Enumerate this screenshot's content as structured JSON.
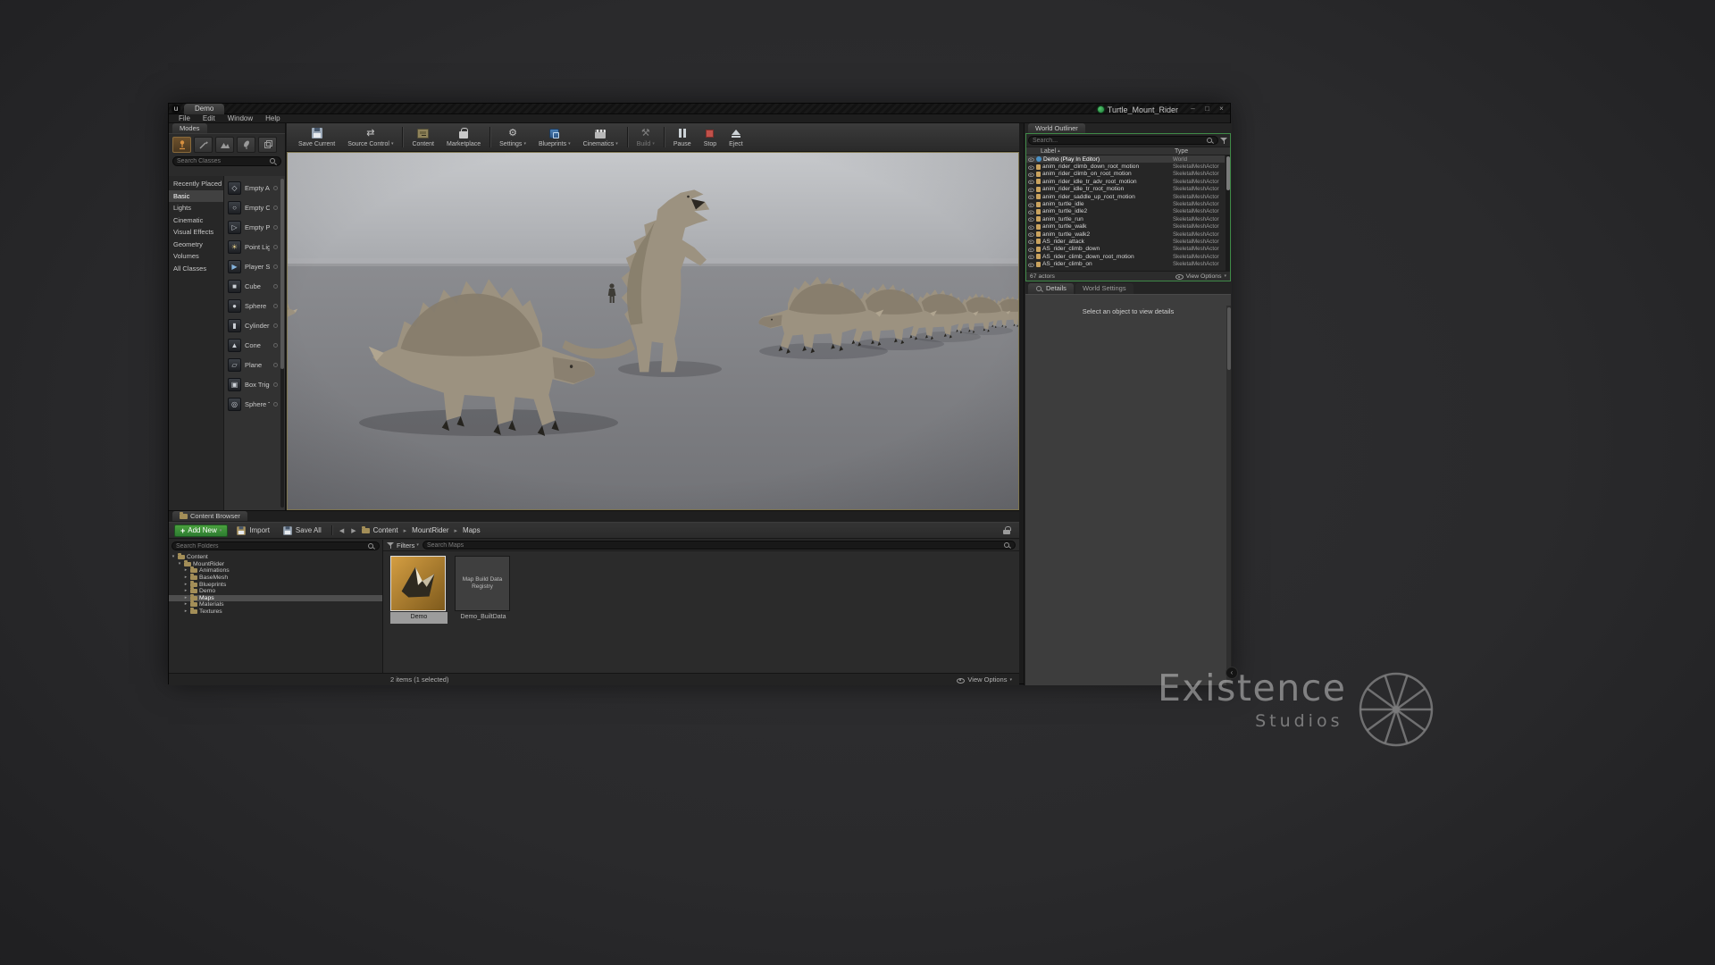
{
  "window": {
    "logo": "u",
    "tab": "Demo",
    "title": "Turtle_Mount_Rider",
    "menu": [
      "File",
      "Edit",
      "Window",
      "Help"
    ]
  },
  "icons": {
    "caret_down": "▾",
    "caret_right": "▸",
    "arrow_back": "◀",
    "arrow_fwd": "▶",
    "sort_asc": "▴",
    "plus": "+",
    "gear": "⚙",
    "build": "⚒",
    "source_control": "⇄",
    "minimize": "–",
    "maximize": "□",
    "close": "×",
    "collapse": "‹"
  },
  "modes": {
    "tab": "Modes",
    "search_placeholder": "Search Classes",
    "categories": [
      "Recently Placed",
      "Basic",
      "Lights",
      "Cinematic",
      "Visual Effects",
      "Geometry",
      "Volumes",
      "All Classes"
    ],
    "active_category": "Basic",
    "items": [
      "Empty Actor",
      "Empty Chara",
      "Empty Pawn",
      "Point Light",
      "Player Start",
      "Cube",
      "Sphere",
      "Cylinder",
      "Cone",
      "Plane",
      "Box Trigger",
      "Sphere Trigg"
    ]
  },
  "toolbar": {
    "save_current": "Save Current",
    "source_control": "Source Control",
    "content": "Content",
    "marketplace": "Marketplace",
    "settings": "Settings",
    "blueprints": "Blueprints",
    "cinematics": "Cinematics",
    "build": "Build",
    "pause": "Pause",
    "stop": "Stop",
    "eject": "Eject"
  },
  "outliner": {
    "tab": "World Outliner",
    "search_placeholder": "Search...",
    "col_label": "Label",
    "col_type": "Type",
    "rows": [
      {
        "label": "Demo (Play In Editor)",
        "type": "World"
      },
      {
        "label": "anim_rider_climb_down_root_motion",
        "type": "SkeletalMeshActor"
      },
      {
        "label": "anim_rider_climb_on_root_motion",
        "type": "SkeletalMeshActor"
      },
      {
        "label": "anim_rider_idle_tr_adv_root_motion",
        "type": "SkeletalMeshActor"
      },
      {
        "label": "anim_rider_idle_tr_root_motion",
        "type": "SkeletalMeshActor"
      },
      {
        "label": "anim_rider_saddle_up_root_motion",
        "type": "SkeletalMeshActor"
      },
      {
        "label": "anim_turtle_idle",
        "type": "SkeletalMeshActor"
      },
      {
        "label": "anim_turtle_idle2",
        "type": "SkeletalMeshActor"
      },
      {
        "label": "anim_turtle_run",
        "type": "SkeletalMeshActor"
      },
      {
        "label": "anim_turtle_walk",
        "type": "SkeletalMeshActor"
      },
      {
        "label": "anim_turtle_walk2",
        "type": "SkeletalMeshActor"
      },
      {
        "label": "AS_rider_attack",
        "type": "SkeletalMeshActor"
      },
      {
        "label": "AS_rider_climb_down",
        "type": "SkeletalMeshActor"
      },
      {
        "label": "AS_rider_climb_down_root_motion",
        "type": "SkeletalMeshActor"
      },
      {
        "label": "AS_rider_climb_on",
        "type": "SkeletalMeshActor"
      }
    ],
    "status": "67 actors",
    "view_options": "View Options"
  },
  "details": {
    "tab_details": "Details",
    "tab_world_settings": "World Settings",
    "empty_message": "Select an object to view details"
  },
  "content_browser": {
    "tab": "Content Browser",
    "add_new": "Add New",
    "import": "Import",
    "save_all": "Save All",
    "breadcrumb": [
      "Content",
      "MountRider",
      "Maps"
    ],
    "search_folders_placeholder": "Search Folders",
    "filters": "Filters",
    "search_assets_placeholder": "Search Maps",
    "tree": [
      {
        "label": "Content",
        "depth": 0,
        "expanded": true
      },
      {
        "label": "MountRider",
        "depth": 1,
        "expanded": true
      },
      {
        "label": "Animations",
        "depth": 2
      },
      {
        "label": "BaseMesh",
        "depth": 2
      },
      {
        "label": "Blueprints",
        "depth": 2
      },
      {
        "label": "Demo",
        "depth": 2
      },
      {
        "label": "Maps",
        "depth": 2,
        "selected": true
      },
      {
        "label": "Materials",
        "depth": 2
      },
      {
        "label": "Textures",
        "depth": 2
      }
    ],
    "assets": [
      {
        "name": "Demo",
        "selected": true
      },
      {
        "name": "Demo_BuiltData",
        "thumb_text": "Map Build Data Registry",
        "selected": false
      }
    ],
    "status": "2 items (1 selected)",
    "view_options": "View Options"
  },
  "watermark": {
    "line1": "Existence",
    "line2": "Studios"
  },
  "colors": {
    "accent_green": "#2e9e4f",
    "pie_border_green": "#3f8a47",
    "viewport_border": "#7d744e",
    "add_new_green": "#3a8f3a",
    "asset_thumb_amber": "#c8913a",
    "stop_red": "#c0514a"
  }
}
